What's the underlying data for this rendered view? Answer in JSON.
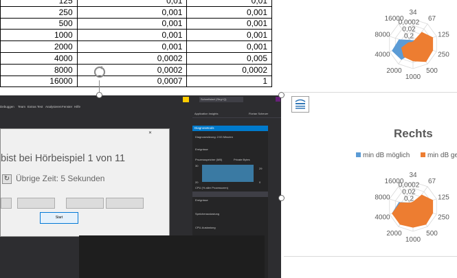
{
  "table": {
    "rows": [
      [
        "125",
        "0,01",
        "0,01"
      ],
      [
        "250",
        "0,001",
        "0,001"
      ],
      [
        "500",
        "0,001",
        "0,001"
      ],
      [
        "1000",
        "0,001",
        "0,001"
      ],
      [
        "2000",
        "0,001",
        "0,001"
      ],
      [
        "4000",
        "0,0002",
        "0,005"
      ],
      [
        "8000",
        "0,0002",
        "0,0002"
      ],
      [
        "16000",
        "0,0007",
        "1"
      ]
    ]
  },
  "app": {
    "dialog_title": "bist bei Hörbeispiel 1 von 11",
    "remaining_time": "Übrige Zeit: 5 Sekunden",
    "start_button": "Start",
    "diag_title": "Diagnosetools",
    "menu_items": [
      "Debuggen",
      "Team",
      "Extras",
      "Test",
      "Analysieren",
      "Fenster",
      "Hilfe"
    ],
    "toolbar_item": "Application Insights",
    "user_name": "Florian Scheuer",
    "quick_launch": "Schnellstart (Strg+Q)",
    "diag_lines": [
      "Diagnosesitzung: 2:53 Minuten",
      "Ereignisse",
      "Prozessspeicher (MB)",
      "Private Bytes",
      "CPU (% aller Prozessoren)",
      "Ereignisse",
      "Speicherauslastung",
      "CPU-Auslastung"
    ],
    "diag_values": [
      "30",
      "29",
      "20",
      "0"
    ]
  },
  "charts": {
    "title": "Rechts",
    "legend": [
      "min dB möglich",
      "min dB ge"
    ],
    "colors": {
      "series1": "#5b9bd5",
      "series2": "#ed7d31",
      "grid": "#d9d9d9",
      "text": "#595959"
    },
    "axis_labels": [
      "34",
      "67",
      "125",
      "250",
      "500",
      "1000",
      "2000",
      "4000",
      "8000",
      "16000"
    ],
    "rings": [
      "0,0002",
      "0,02",
      "0,2"
    ]
  }
}
